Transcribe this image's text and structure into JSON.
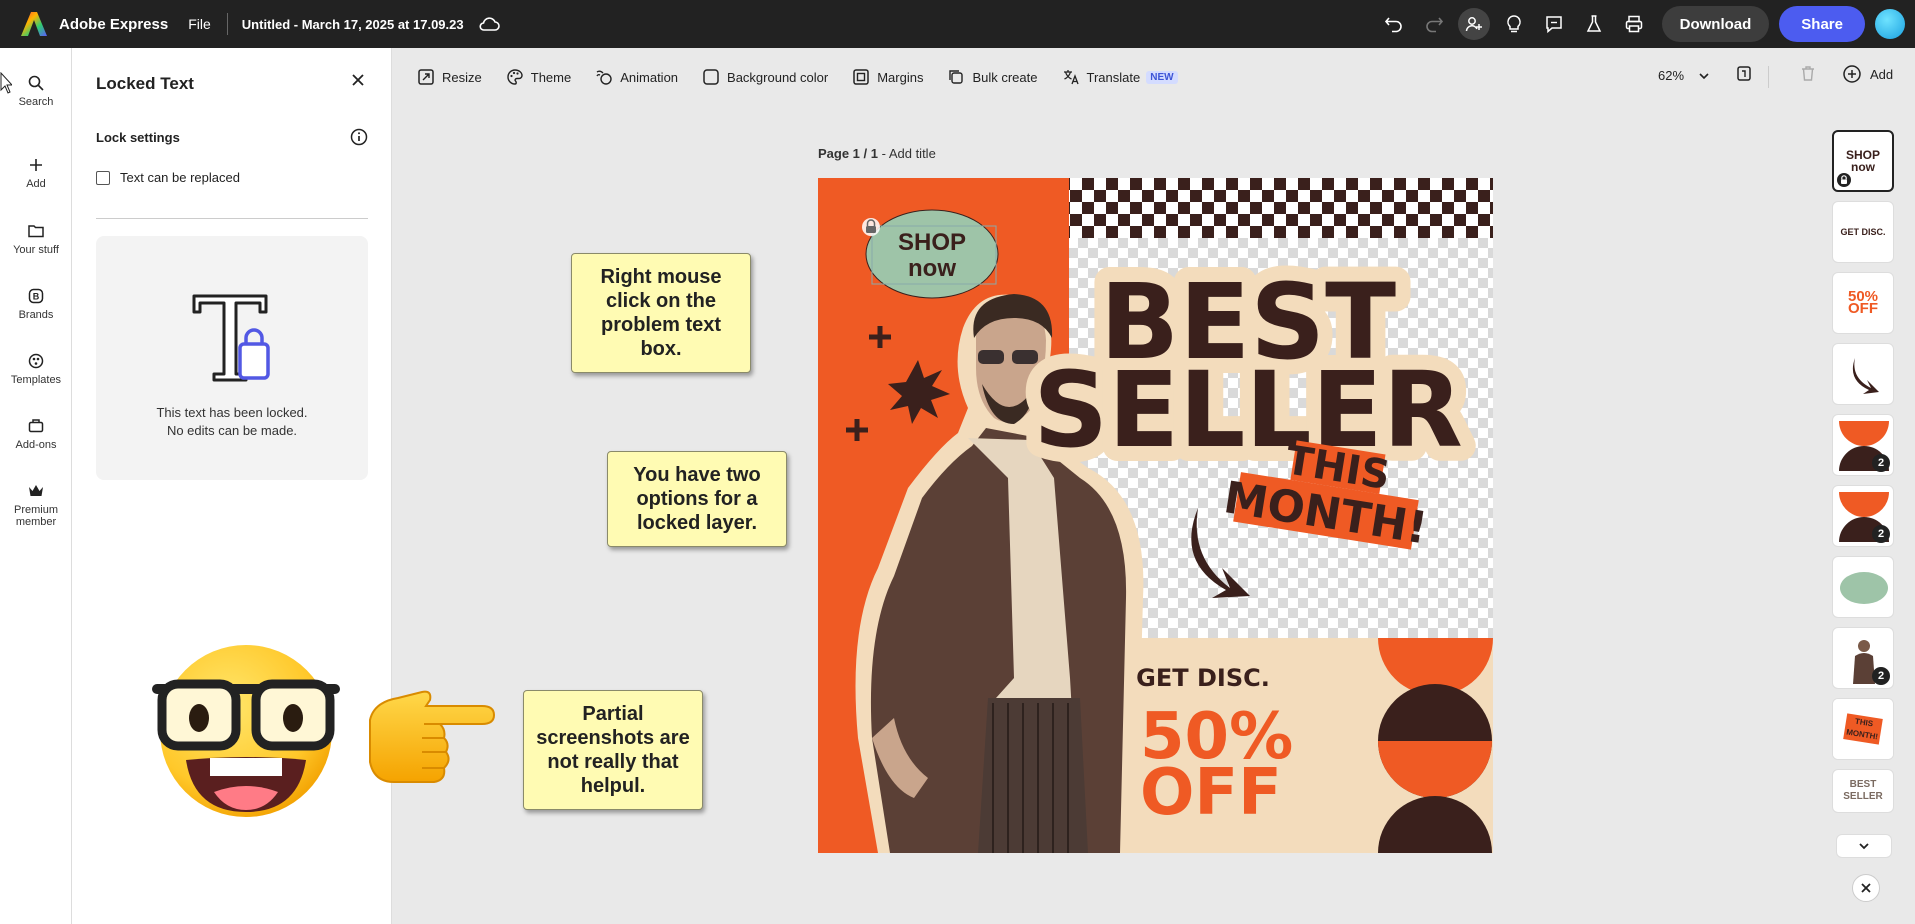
{
  "topbar": {
    "app_name": "Adobe Express",
    "file_label": "File",
    "doc_title": "Untitled - March 17, 2025 at 17.09.23",
    "download_label": "Download",
    "share_label": "Share"
  },
  "rail": {
    "items": [
      {
        "label": "Search",
        "icon": "search-icon"
      },
      {
        "label": "Add",
        "icon": "plus-icon"
      },
      {
        "label": "Your stuff",
        "icon": "folder-icon"
      },
      {
        "label": "Brands",
        "icon": "brand-icon"
      },
      {
        "label": "Templates",
        "icon": "templates-icon"
      },
      {
        "label": "Add-ons",
        "icon": "addons-icon"
      },
      {
        "label": "Premium",
        "label2": "member",
        "icon": "crown-icon"
      }
    ]
  },
  "panel": {
    "title": "Locked Text",
    "section_title": "Lock settings",
    "checkbox_label": "Text can be replaced",
    "checkbox_checked": false,
    "locked_line1": "This text has been locked.",
    "locked_line2": "No edits can be made."
  },
  "notes": {
    "note1": "Right mouse click on the problem text box.",
    "note2": "You have two options for a locked layer.",
    "note3": "Partial screenshots are not really that helpul."
  },
  "toolbar": {
    "resize": "Resize",
    "theme": "Theme",
    "animation": "Animation",
    "background_color": "Background color",
    "margins": "Margins",
    "bulk_create": "Bulk create",
    "translate": "Translate",
    "translate_badge": "NEW",
    "zoom": "62%",
    "add": "Add"
  },
  "page": {
    "label_bold": "Page 1 / 1",
    "label_rest": " - Add title"
  },
  "artwork": {
    "shop_line1": "SHOP",
    "shop_line2": "now",
    "best": "BEST",
    "seller": "SELLER",
    "this": "THIS",
    "month": "MONTH!",
    "get_disc": "GET DISC.",
    "pct": "50%",
    "off": "OFF",
    "colors": {
      "orange": "#ef5a24",
      "dark": "#3a201c",
      "cream": "#f3dcbc",
      "mint": "#9ec4a8"
    }
  },
  "thumbnails": [
    {
      "text1": "SHOP",
      "text2": "now",
      "count": ""
    },
    {
      "text1": "GET DISC.",
      "text2": "",
      "count": ""
    },
    {
      "text1": "50%",
      "text2": "OFF",
      "count": ""
    },
    {
      "text1": "",
      "text2": "",
      "count": ""
    },
    {
      "text1": "",
      "text2": "",
      "count": "2"
    },
    {
      "text1": "",
      "text2": "",
      "count": "2"
    },
    {
      "text1": "",
      "text2": "",
      "count": ""
    },
    {
      "text1": "",
      "text2": "",
      "count": "2"
    },
    {
      "text1": "THIS",
      "text2": "MONTH!",
      "count": ""
    },
    {
      "text1": "BEST",
      "text2": "SELLER",
      "count": ""
    }
  ]
}
